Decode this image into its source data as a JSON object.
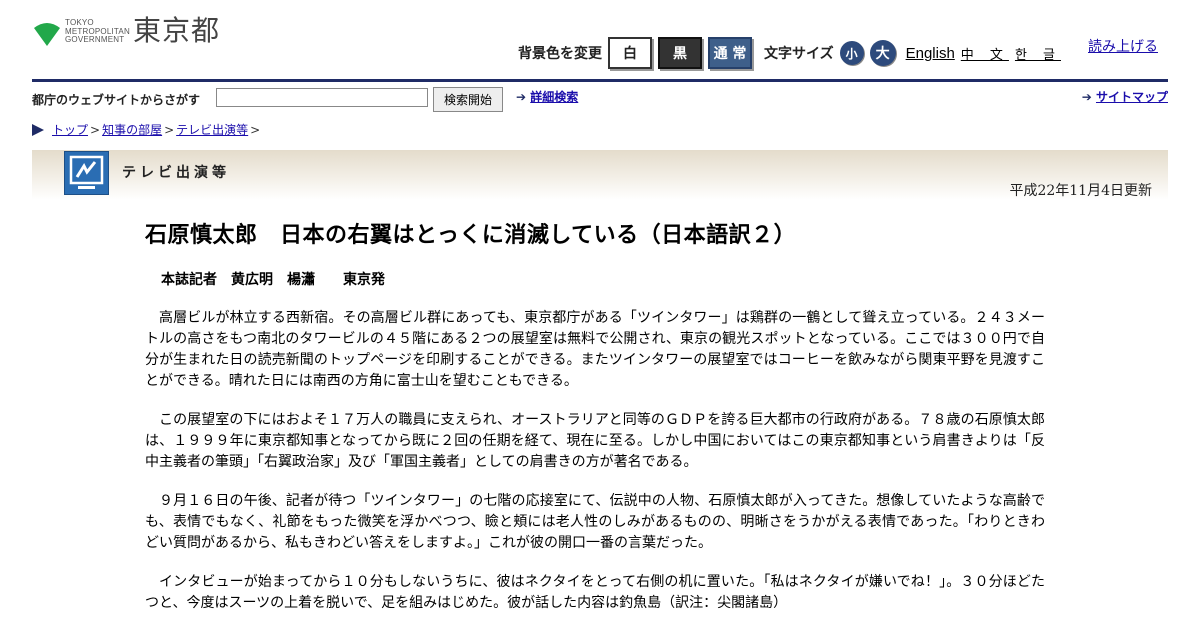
{
  "header": {
    "logo_small": [
      "TOKYO",
      "METROPOLITAN",
      "GOVERNMENT"
    ],
    "logo_big": "東京都",
    "bg_label": "背景色を変更",
    "bg_options": [
      "白",
      "黒",
      "通 常"
    ],
    "text_size_label": "文字サイズ",
    "text_sizes": [
      "小",
      "大"
    ],
    "languages": [
      "English",
      "中 文",
      "한 글"
    ],
    "read_aloud": "読み上げる"
  },
  "search": {
    "label": "都庁のウェブサイトからさがす",
    "input_value": "",
    "button": "検索開始",
    "advanced": "詳細検索",
    "sitemap": "サイトマップ"
  },
  "breadcrumb": [
    "トップ",
    "知事の部屋",
    "テレビ出演等"
  ],
  "section": {
    "title": "テレビ出演等",
    "updated": "平成22年11月4日更新"
  },
  "article": {
    "title": "石原慎太郎　日本の右翼はとっくに消滅している（日本語訳２）",
    "byline": "本誌記者　黄広明　楊瀟　　東京発",
    "paragraphs": [
      "高層ビルが林立する西新宿。その高層ビル群にあっても、東京都庁がある「ツインタワー」は鶏群の一鶴として聳え立っている。２４３メートルの高さをもつ南北のタワービルの４５階にある２つの展望室は無料で公開され、東京の観光スポットとなっている。ここでは３００円で自分が生まれた日の読売新聞のトップページを印刷することができる。またツインタワーの展望室ではコーヒーを飲みながら関東平野を見渡すことができる。晴れた日には南西の方角に富士山を望むこともできる。",
      "この展望室の下にはおよそ１７万人の職員に支えられ、オーストラリアと同等のＧＤＰを誇る巨大都市の行政府がある。７８歳の石原慎太郎は、１９９９年に東京都知事となってから既に２回の任期を経て、現在に至る。しかし中国においてはこの東京都知事という肩書きよりは「反中主義者の筆頭」「右翼政治家」及び「軍国主義者」としての肩書きの方が著名である。",
      "９月１６日の午後、記者が待つ「ツインタワー」の七階の応接室にて、伝説中の人物、石原慎太郎が入ってきた。想像していたような高齢でも、表情でもなく、礼節をもった微笑を浮かべつつ、瞼と頬には老人性のしみがあるものの、明晰さをうかがえる表情であった。「わりときわどい質問があるから、私もきわどい答えをしますよ。」これが彼の開口一番の言葉だった。",
      "インタビューが始まってから１０分もしないうちに、彼はネクタイをとって右側の机に置いた。「私はネクタイが嫌いでね！」。３０分ほどたつと、今度はスーツの上着を脱いで、足を組みはじめた。彼が話した内容は釣魚島（訳注：尖閣諸島）"
    ]
  },
  "colors": {
    "navy": "#1f2b66",
    "link": "#1a0dab",
    "logo_green": "#22a84a",
    "icon_blue": "#2a6db3"
  }
}
